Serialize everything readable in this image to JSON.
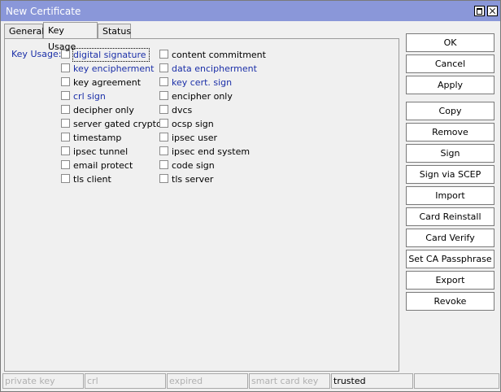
{
  "window": {
    "title": "New Certificate"
  },
  "tabs": [
    {
      "label": "General",
      "active": false
    },
    {
      "label": "Key Usage",
      "active": true
    },
    {
      "label": "Status",
      "active": false
    }
  ],
  "key_usage": {
    "label": "Key Usage:",
    "column1": [
      {
        "label": "digital signature",
        "checked": false,
        "highlight": true,
        "focused": true
      },
      {
        "label": "key encipherment",
        "checked": false,
        "highlight": true
      },
      {
        "label": "key agreement",
        "checked": false,
        "highlight": false
      },
      {
        "label": "crl sign",
        "checked": false,
        "highlight": true
      },
      {
        "label": "decipher only",
        "checked": false,
        "highlight": false
      },
      {
        "label": "server gated crypto",
        "checked": false,
        "highlight": false
      },
      {
        "label": "timestamp",
        "checked": false,
        "highlight": false
      },
      {
        "label": "ipsec tunnel",
        "checked": false,
        "highlight": false
      },
      {
        "label": "email protect",
        "checked": false,
        "highlight": false
      },
      {
        "label": "tls client",
        "checked": false,
        "highlight": false
      }
    ],
    "column2": [
      {
        "label": "content commitment",
        "checked": false,
        "highlight": false
      },
      {
        "label": "data encipherment",
        "checked": false,
        "highlight": true
      },
      {
        "label": "key cert. sign",
        "checked": false,
        "highlight": true
      },
      {
        "label": "encipher only",
        "checked": false,
        "highlight": false
      },
      {
        "label": "dvcs",
        "checked": false,
        "highlight": false
      },
      {
        "label": "ocsp sign",
        "checked": false,
        "highlight": false
      },
      {
        "label": "ipsec user",
        "checked": false,
        "highlight": false
      },
      {
        "label": "ipsec end system",
        "checked": false,
        "highlight": false
      },
      {
        "label": "code sign",
        "checked": false,
        "highlight": false
      },
      {
        "label": "tls server",
        "checked": false,
        "highlight": false
      }
    ]
  },
  "buttons": [
    "OK",
    "Cancel",
    "Apply",
    "Copy",
    "Remove",
    "Sign",
    "Sign via SCEP",
    "Import",
    "Card Reinstall",
    "Card Verify",
    "Set CA Passphrase",
    "Export",
    "Revoke"
  ],
  "status": [
    {
      "label": "private key",
      "active": false
    },
    {
      "label": "crl",
      "active": false
    },
    {
      "label": "expired",
      "active": false
    },
    {
      "label": "smart card key",
      "active": false
    },
    {
      "label": "trusted",
      "active": true
    },
    {
      "label": "",
      "active": false
    }
  ],
  "colors": {
    "title_bar": "#8a97d9",
    "link_text": "#1b2fa8"
  }
}
